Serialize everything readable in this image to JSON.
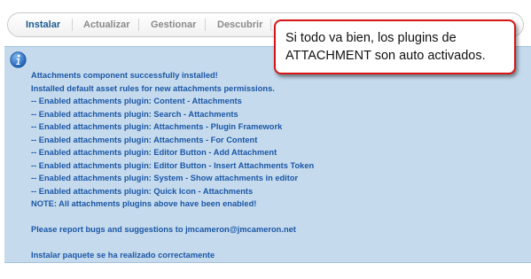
{
  "tabs": [
    {
      "label": "Instalar",
      "active": true
    },
    {
      "label": "Actualizar",
      "active": false
    },
    {
      "label": "Gestionar",
      "active": false
    },
    {
      "label": "Descubrir",
      "active": false
    }
  ],
  "info_icon": "info-icon",
  "messages": {
    "lines": [
      "Attachments component successfully installed!",
      "Installed default asset rules for new attachments permissions.",
      "-- Enabled attachments plugin: Content - Attachments",
      "-- Enabled attachments plugin: Search - Attachments",
      "-- Enabled attachments plugin: Attachments - Plugin Framework",
      "-- Enabled attachments plugin: Attachments - For Content",
      "-- Enabled attachments plugin: Editor Button - Add Attachment",
      "-- Enabled attachments plugin: Editor Button - Insert Attachments Token",
      "-- Enabled attachments plugin: System - Show attachments in editor",
      "-- Enabled attachments plugin: Quick Icon - Attachments",
      "NOTE: All attachments plugins above have been enabled!"
    ],
    "report": "Please report bugs and suggestions to jmcameron@jmcameron.net",
    "result": "Instalar paquete se ha realizado correctamente"
  },
  "callout": {
    "line1": "Si todo va bien, los plugins de",
    "line2": "ATTACHMENT son auto activados."
  },
  "colors": {
    "panel_bg": "#c5dbed",
    "message_text": "#1b56a6",
    "active_tab": "#1a5b94",
    "callout_border": "#d41616"
  }
}
